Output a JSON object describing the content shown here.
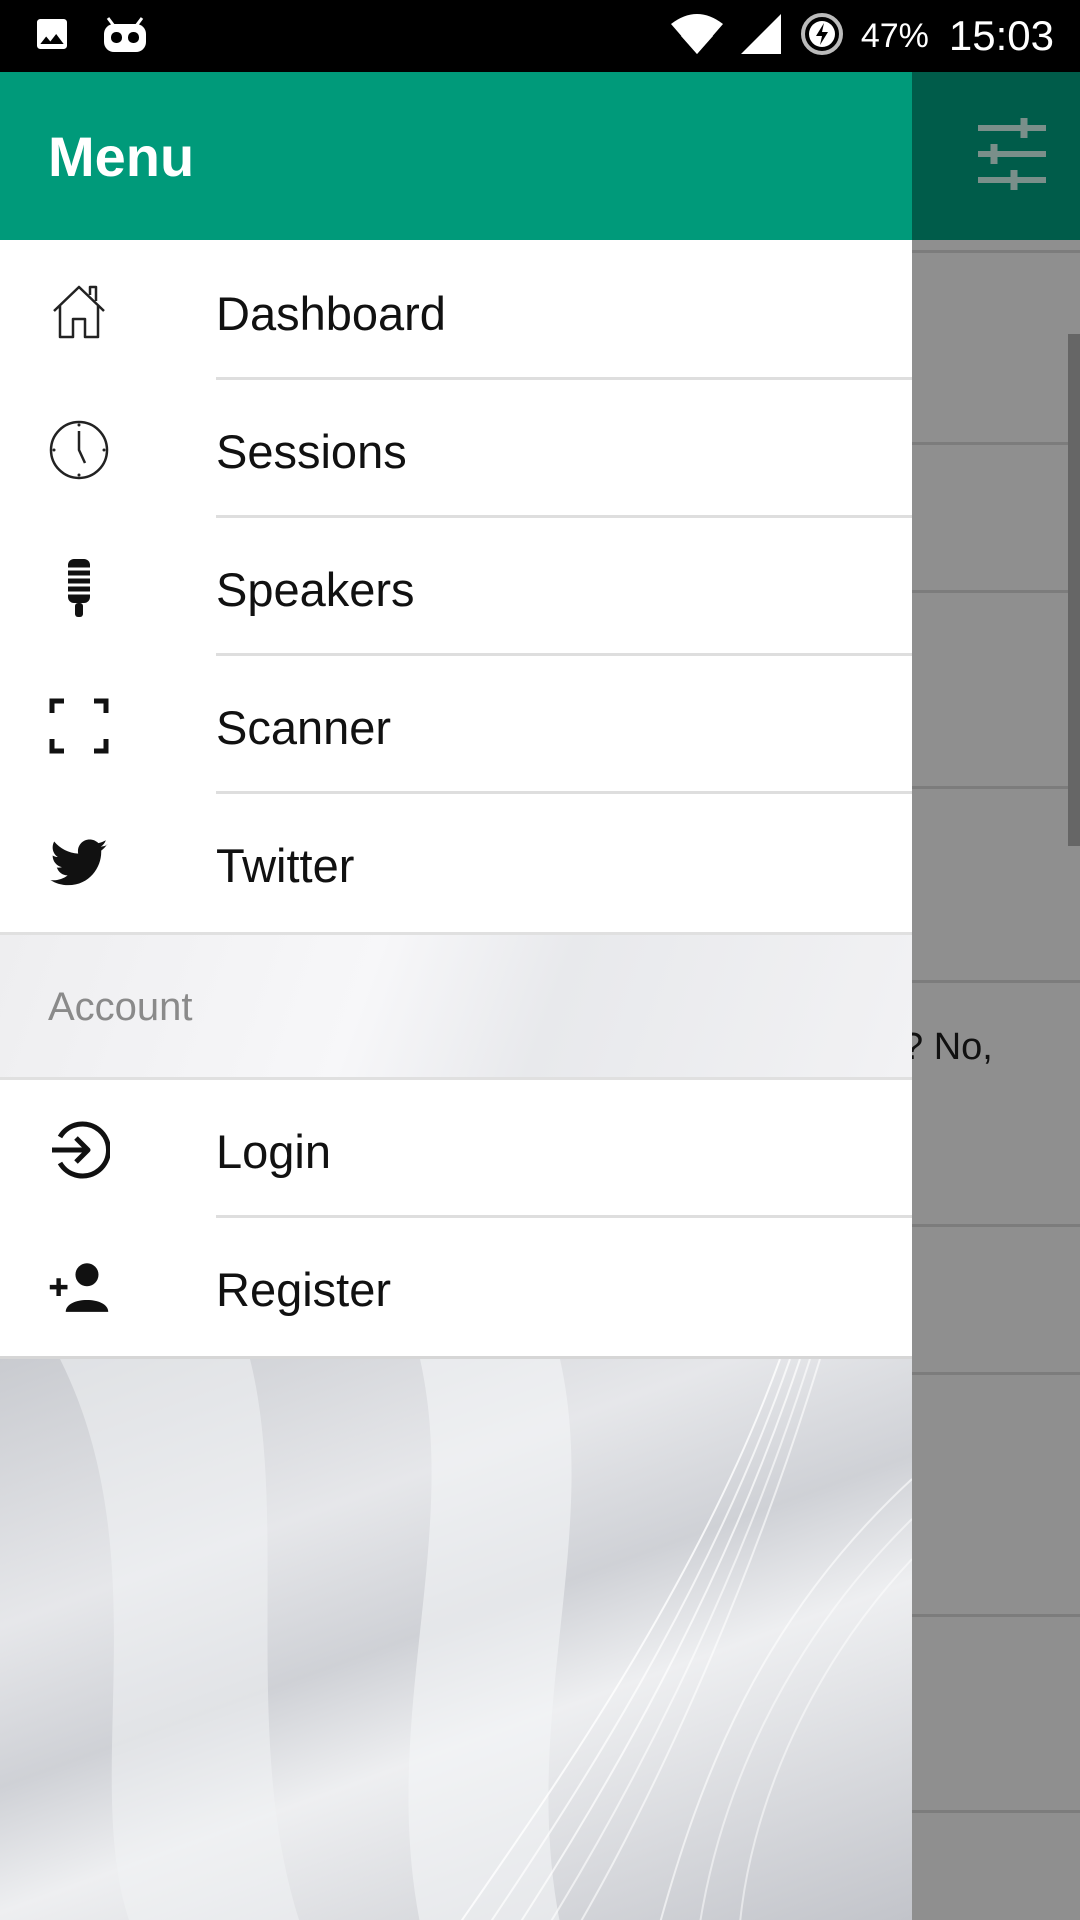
{
  "status_bar": {
    "battery_pct": "47%",
    "time": "15:03",
    "icons": [
      "image-icon",
      "android-bot-icon",
      "wifi-icon",
      "signal-icon",
      "battery-charging-icon"
    ]
  },
  "drawer": {
    "title": "Menu",
    "nav_items": [
      {
        "label": "Dashboard",
        "icon": "home-icon"
      },
      {
        "label": "Sessions",
        "icon": "clock-icon"
      },
      {
        "label": "Speakers",
        "icon": "microphone-icon"
      },
      {
        "label": "Scanner",
        "icon": "scan-frame-icon"
      },
      {
        "label": "Twitter",
        "icon": "twitter-icon"
      }
    ],
    "account_section": {
      "title": "Account",
      "items": [
        {
          "label": "Login",
          "icon": "login-icon"
        },
        {
          "label": "Register",
          "icon": "add-person-icon"
        }
      ]
    }
  },
  "background_app": {
    "action_icon": "tune-icon",
    "visible_text": "? No,"
  },
  "colors": {
    "header": "#009a7a",
    "dimmed_toolbar": "#005c4a"
  }
}
